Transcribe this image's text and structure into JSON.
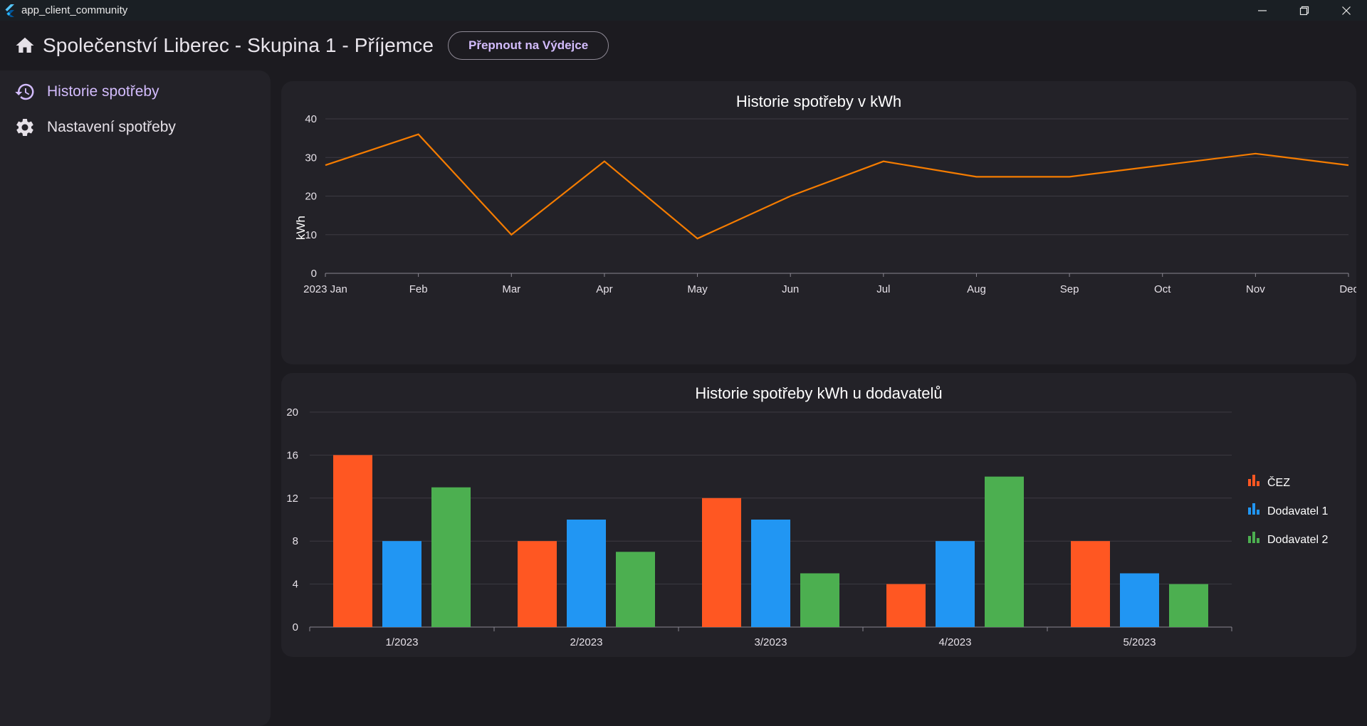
{
  "window": {
    "title": "app_client_community"
  },
  "header": {
    "title": "Společenství Liberec - Skupina 1 - Příjemce",
    "switch_button": "Přepnout na Výdejce"
  },
  "sidebar": {
    "items": [
      {
        "label": "Historie spotřeby",
        "icon": "history-icon",
        "active": true
      },
      {
        "label": "Nastavení spotřeby",
        "icon": "gear-icon",
        "active": false
      }
    ]
  },
  "colors": {
    "accent": "#d3bcfd",
    "line": "#f57c00",
    "cez": "#ff5722",
    "dodavatel1": "#2196f3",
    "dodavatel2": "#4caf50"
  },
  "chart_data": [
    {
      "type": "line",
      "title": "Historie spotřeby v kWh",
      "ylabel": "kWh",
      "xlabel": "",
      "categories": [
        "2023 Jan",
        "Feb",
        "Mar",
        "Apr",
        "May",
        "Jun",
        "Jul",
        "Aug",
        "Sep",
        "Oct",
        "Nov",
        "Dec"
      ],
      "series": [
        {
          "values": [
            28,
            36,
            10,
            29,
            9,
            20,
            29,
            25,
            25,
            28,
            31,
            28
          ]
        }
      ],
      "ylim": [
        0,
        40
      ],
      "yticks": [
        0,
        10,
        20,
        30,
        40
      ],
      "grid": true
    },
    {
      "type": "bar",
      "title": "Historie spotřeby kWh u dodavatelů",
      "categories": [
        "1/2023",
        "2/2023",
        "3/2023",
        "4/2023",
        "5/2023"
      ],
      "series": [
        {
          "name": "ČEZ",
          "values": [
            16,
            8,
            12,
            4,
            8
          ]
        },
        {
          "name": "Dodavatel 1",
          "values": [
            8,
            10,
            10,
            8,
            5
          ]
        },
        {
          "name": "Dodavatel 2",
          "values": [
            13,
            7,
            5,
            14,
            4
          ]
        }
      ],
      "ylim": [
        0,
        20
      ],
      "yticks": [
        0,
        4,
        8,
        12,
        16,
        20
      ],
      "legend": "right",
      "grid": true
    }
  ]
}
